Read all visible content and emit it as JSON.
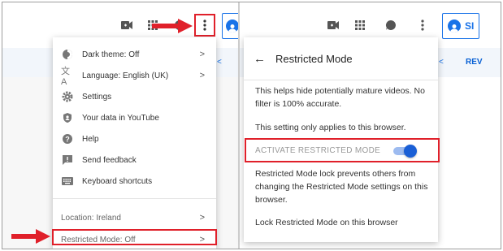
{
  "left_menu": {
    "items": [
      {
        "icon": "moon-icon",
        "label": "Dark theme: Off",
        "has_chevron": true
      },
      {
        "icon": "translate-icon",
        "label": "Language: English (UK)",
        "has_chevron": true
      },
      {
        "icon": "gear-icon",
        "label": "Settings",
        "has_chevron": false
      },
      {
        "icon": "shield-person-icon",
        "label": "Your data in YouTube",
        "has_chevron": false
      },
      {
        "icon": "help-icon",
        "label": "Help",
        "has_chevron": false
      },
      {
        "icon": "feedback-icon",
        "label": "Send feedback",
        "has_chevron": false
      },
      {
        "icon": "keyboard-icon",
        "label": "Keyboard shortcuts",
        "has_chevron": false
      }
    ],
    "location": "Location: Ireland",
    "restricted_mode": "Restricted Mode: Off",
    "chevron": ">"
  },
  "right_panel": {
    "title": "Restricted Mode",
    "back_glyph": "←",
    "description": "This helps hide potentially mature videos. No filter is 100% accurate.",
    "browser_note": "This setting only applies to this browser.",
    "toggle_label": "ACTIVATE RESTRICTED MODE",
    "toggle_on": true,
    "lock_note": "Restricted Mode lock prevents others from changing the Restricted Mode settings on this browser.",
    "lock_action": "Lock Restricted Mode on this browser"
  },
  "header": {
    "signin_partial": "SI",
    "tab_partial": "REV",
    "tab_chevron_glyph": "<"
  },
  "colors": {
    "highlight_red": "#e0202a",
    "accent_blue": "#1a73e8",
    "toggle_knob": "#1a5fd6"
  }
}
